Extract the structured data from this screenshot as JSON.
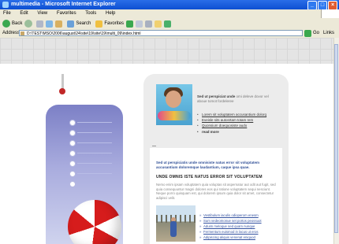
{
  "window": {
    "title": "multimedia - Microsoft Internet Explorer"
  },
  "menu": [
    "File",
    "Edit",
    "View",
    "Favorites",
    "Tools",
    "Help"
  ],
  "toolbar": {
    "back": "Back",
    "search": "Search",
    "favorites": "Favorites"
  },
  "address": {
    "label": "Address",
    "value": "D:\\TEST\\MSO\\2006\\august\\24\\site\\19\\site\\19\\multi_09\\index.html",
    "go": "Go",
    "links": "Links"
  },
  "intro": {
    "bold": "Sed ut perspiciat unde",
    "text": "omi deleve dovor vel aboue tomot fordeleree"
  },
  "intro_links": [
    "Lorem sit voluptatem accusantium dolorq",
    "Eveisle sits autosrtam totam rem",
    "Quonsium doequosiste audo"
  ],
  "read_more": "read more",
  "tagline": "Sed ut perspiciatis unde omnisiste natus error sit voluptatem accusantium doloremque laudantium, caque ipsa quae.",
  "section_title": "UNDE OMNIS ISTE NATUS ERROR SIT VOLUPTATEM",
  "paragraph": "Nemo enim ipsam voluptatem quia voluptas sit aspernatur aut odit aut fugit, sed quia consequuntur magni dolores eos qui ratione voluptatem sequi nesciunt. Neque porro quisquam est, qui dolorem ipsum quia dolor sit amet, consectetur adipisci velit.",
  "list2": [
    "Vestibulum iaculis odioperom enesm",
    "Sum vedeomonue set portos peossuot",
    "Aduim meloque sed quam nunque",
    "Fermentum euismod in lacus ut eros",
    "Adipiscing aliquis venenat eniquod"
  ],
  "colors": {
    "accent": "#2e4e96",
    "panel": "#7c80c6",
    "ball_red": "#d61c1c"
  }
}
